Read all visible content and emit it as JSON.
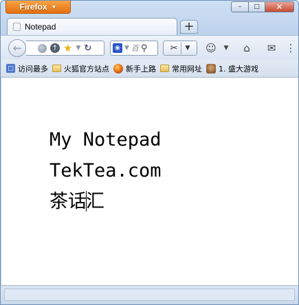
{
  "window": {
    "app_button_label": "Firefox",
    "minimize": "–",
    "maximize": "□",
    "close": "✕"
  },
  "tabs": [
    {
      "label": "Notepad"
    }
  ],
  "new_tab_label": "+",
  "nav": {
    "search_placeholder": "百",
    "reload_glyph": "↻"
  },
  "bookmarks": [
    {
      "label": "访问最多",
      "icon": "bookmarks-menu-icon"
    },
    {
      "label": "火狐官方站点",
      "icon": "folder-icon"
    },
    {
      "label": "新手上路",
      "icon": "firefox-icon"
    },
    {
      "label": "常用网址",
      "icon": "folder-icon"
    },
    {
      "label": "1. 盛大游戏",
      "icon": "game-icon"
    }
  ],
  "content": {
    "lines": [
      "My Notepad",
      "TekTea.com",
      "茶话",
      "汇"
    ]
  },
  "colors": {
    "firefox_orange": "#e4700f",
    "chrome_blue": "#b9cfe9"
  }
}
